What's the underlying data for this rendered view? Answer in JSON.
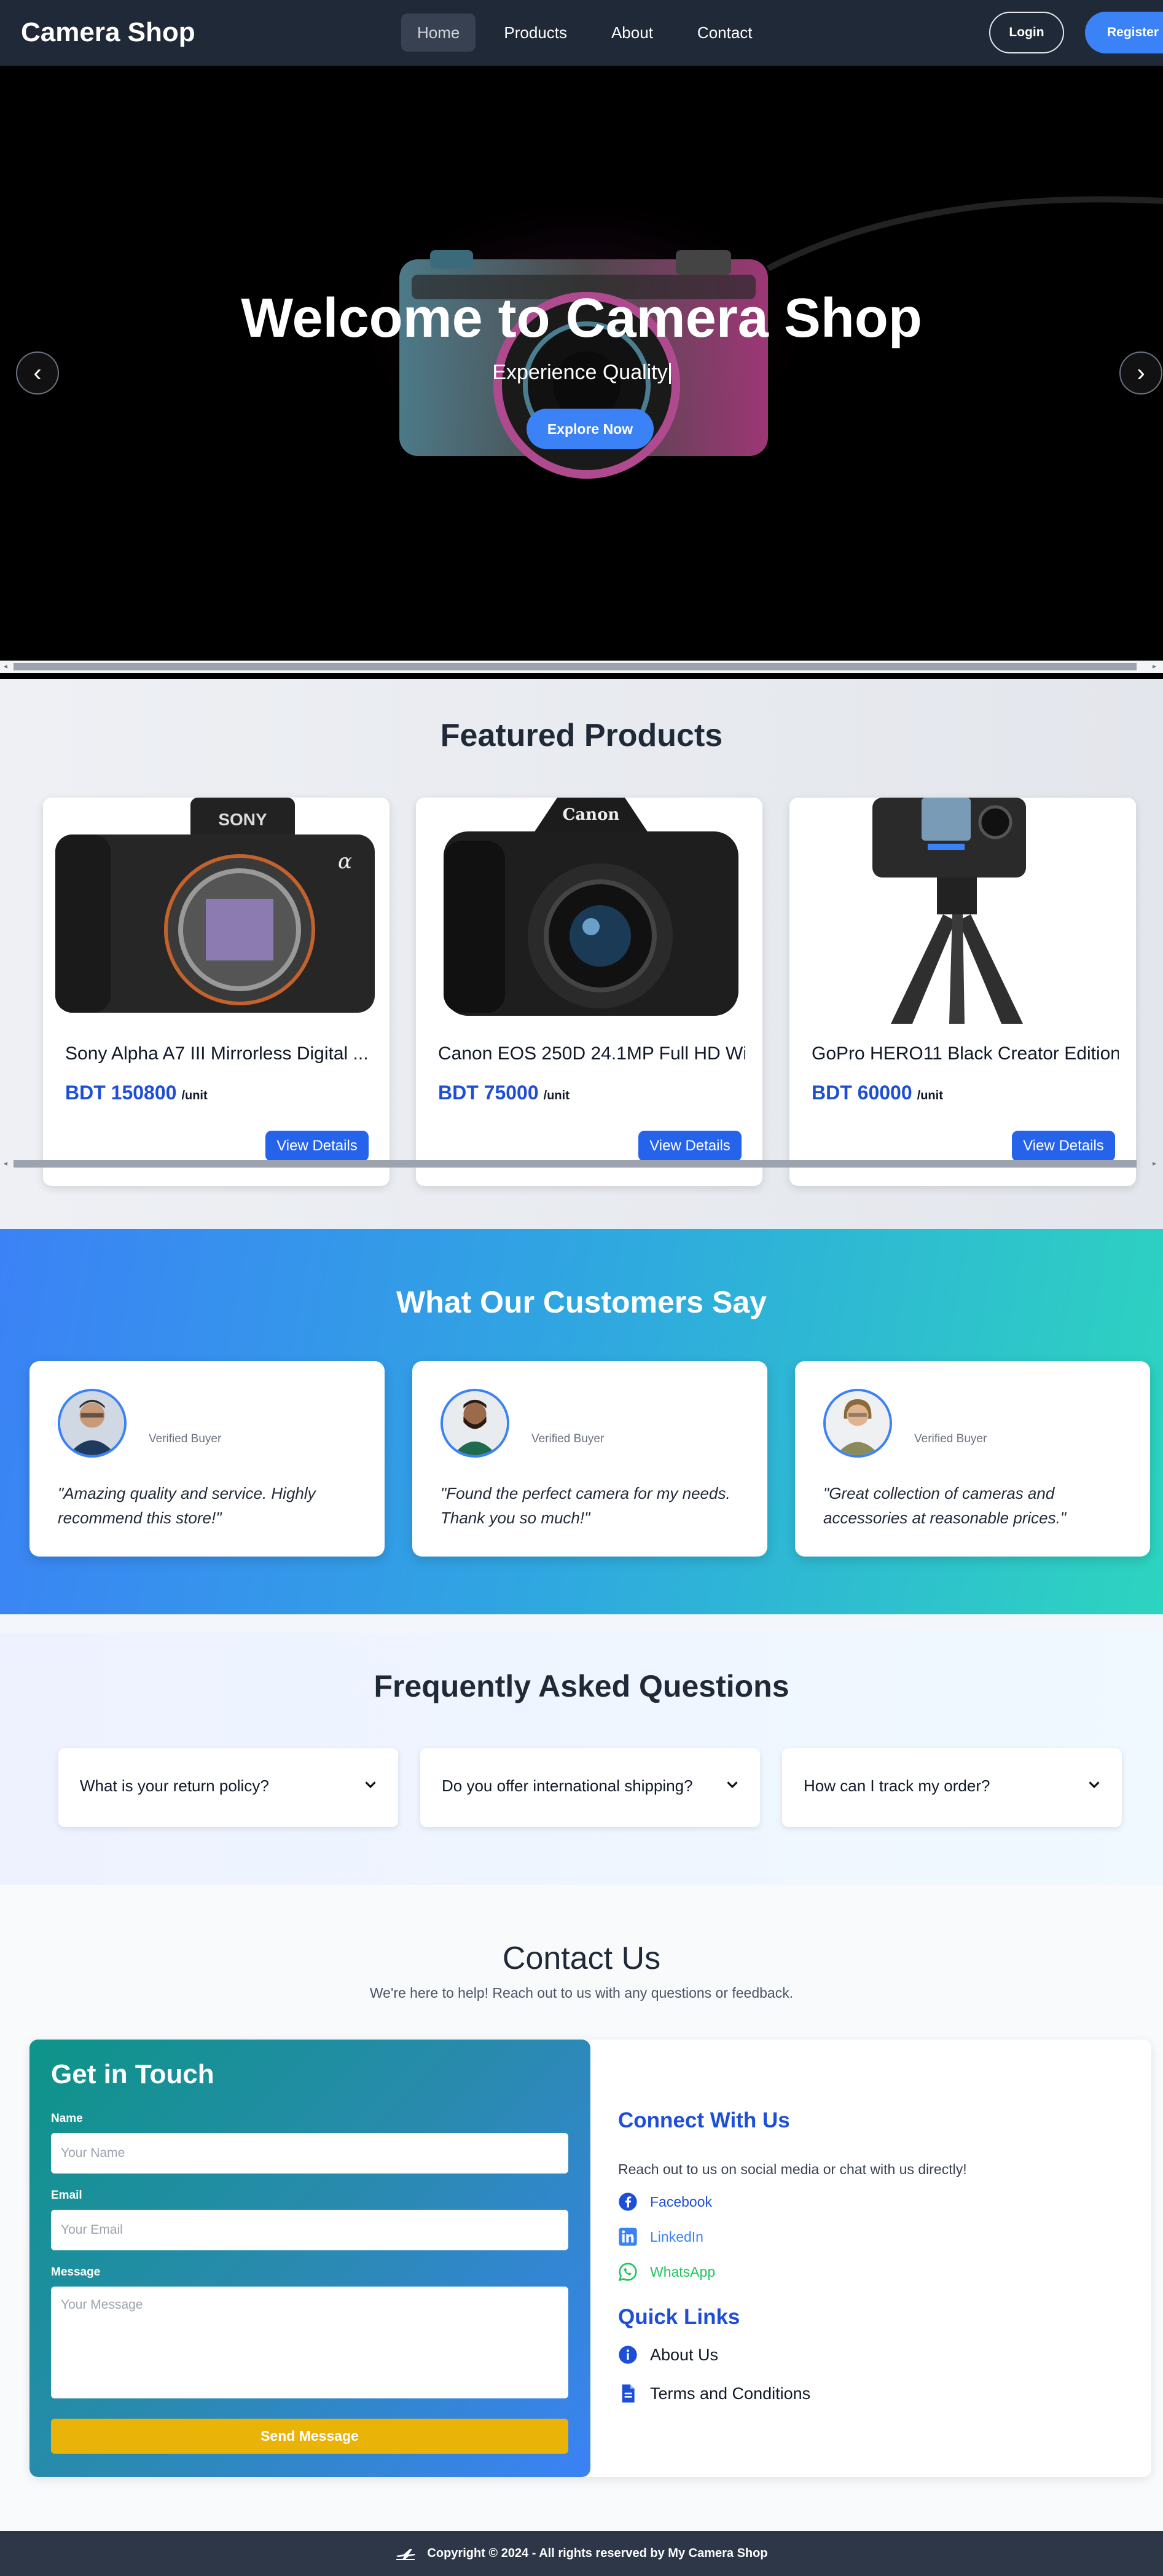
{
  "nav": {
    "brand": "Camera Shop",
    "links": [
      "Home",
      "Products",
      "About",
      "Contact"
    ],
    "active": "Home",
    "login": "Login",
    "register": "Register"
  },
  "hero": {
    "title": "Welcome to Camera Shop",
    "subtitle": "Experience Quality",
    "cta": "Explore Now",
    "prev_icon": "chevron-left-icon",
    "next_icon": "chevron-right-icon"
  },
  "featured": {
    "title": "Featured Products",
    "products": [
      {
        "name": "Sony Alpha A7 III Mirrorless Digital ...",
        "price": "BDT 150800",
        "unit": "/unit",
        "button": "View Details"
      },
      {
        "name": "Canon EOS 250D 24.1MP Full HD Wi...",
        "price": "BDT 75000",
        "unit": "/unit",
        "button": "View Details"
      },
      {
        "name": "GoPro HERO11 Black Creator Edition...",
        "price": "BDT 60000",
        "unit": "/unit",
        "button": "View Details"
      }
    ]
  },
  "testimonials": {
    "title": "What Our Customers Say",
    "items": [
      {
        "badge": "Verified Buyer",
        "quote": "\"Amazing quality and service. Highly recommend this store!\""
      },
      {
        "badge": "Verified Buyer",
        "quote": "\"Found the perfect camera for my needs. Thank you so much!\""
      },
      {
        "badge": "Verified Buyer",
        "quote": "\"Great collection of cameras and accessories at reasonable prices.\""
      }
    ]
  },
  "faq": {
    "title": "Frequently Asked Questions",
    "items": [
      {
        "question": "What is your return policy?"
      },
      {
        "question": "Do you offer international shipping?"
      },
      {
        "question": "How can I track my order?"
      }
    ]
  },
  "contact": {
    "title": "Contact Us",
    "subtitle": "We're here to help! Reach out to us with any questions or feedback.",
    "form": {
      "title": "Get in Touch",
      "name_label": "Name",
      "name_placeholder": "Your Name",
      "email_label": "Email",
      "email_placeholder": "Your Email",
      "message_label": "Message",
      "message_placeholder": "Your Message",
      "submit": "Send Message"
    },
    "connect": {
      "title": "Connect With Us",
      "text": "Reach out to us on social media or chat with us directly!",
      "links": [
        {
          "label": "Facebook",
          "icon": "facebook-icon",
          "color": "#1d4ed8"
        },
        {
          "label": "LinkedIn",
          "icon": "linkedin-icon",
          "color": "#3b82f6"
        },
        {
          "label": "WhatsApp",
          "icon": "whatsapp-icon",
          "color": "#22c55e"
        }
      ]
    },
    "quick": {
      "title": "Quick Links",
      "links": [
        {
          "label": "About Us",
          "icon": "info-icon"
        },
        {
          "label": "Terms and Conditions",
          "icon": "document-icon"
        }
      ]
    }
  },
  "footer": {
    "text": "Copyright © 2024 - All rights reserved by My Camera Shop",
    "icon": "plane-icon"
  },
  "colors": {
    "nav_bg": "#1f2937",
    "accent": "#3b82f6",
    "price": "#1d4ed8",
    "send_button": "#eab308"
  }
}
